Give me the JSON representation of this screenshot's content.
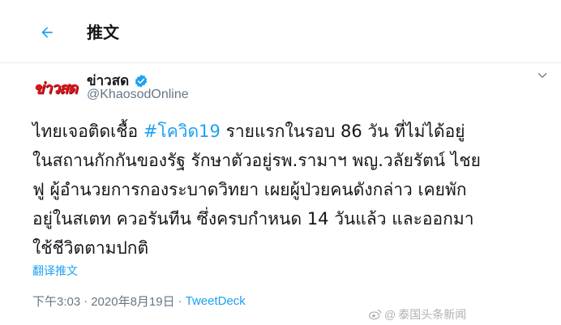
{
  "header": {
    "title": "推文"
  },
  "author": {
    "avatar_text": "ข่าวสด",
    "display_name": "ข่าวสด",
    "handle": "@KhaosodOnline"
  },
  "tweet": {
    "line1_before": "ไทยเจอติดเชื้อ ",
    "hashtag": "#โควิด19",
    "line1_after": " รายแรกในรอบ 86 วัน ที่ไม่ได้อยู่",
    "line2": "ในสถานกักกันของรัฐ รักษาตัวอยู่รพ.รามาฯ พญ.วลัยรัตน์ ไชย",
    "line3": "ฟู ผู้อำนวยการกองระบาดวิทยา เผยผู้ป่วยคนดังกล่าว เคยพัก",
    "line4": "อยู่ในสเตท ควอรันทีน ซึ่งครบกำหนด 14 วันแล้ว และออกมา",
    "line5": "ใช้ชีวิตตามปกติ"
  },
  "translate_label": "翻译推文",
  "meta": {
    "time": "下午3:03",
    "separator": "·",
    "date": "2020年8月19日",
    "source": "TweetDeck"
  },
  "watermark": {
    "text": "泰国头条新闻"
  },
  "colors": {
    "accent": "#1da1f2",
    "secondary_text": "#657786",
    "brand_red": "#e3141c"
  },
  "icons": {
    "back": "arrow-left-icon",
    "verified": "verified-badge-icon",
    "more": "chevron-down-icon"
  }
}
